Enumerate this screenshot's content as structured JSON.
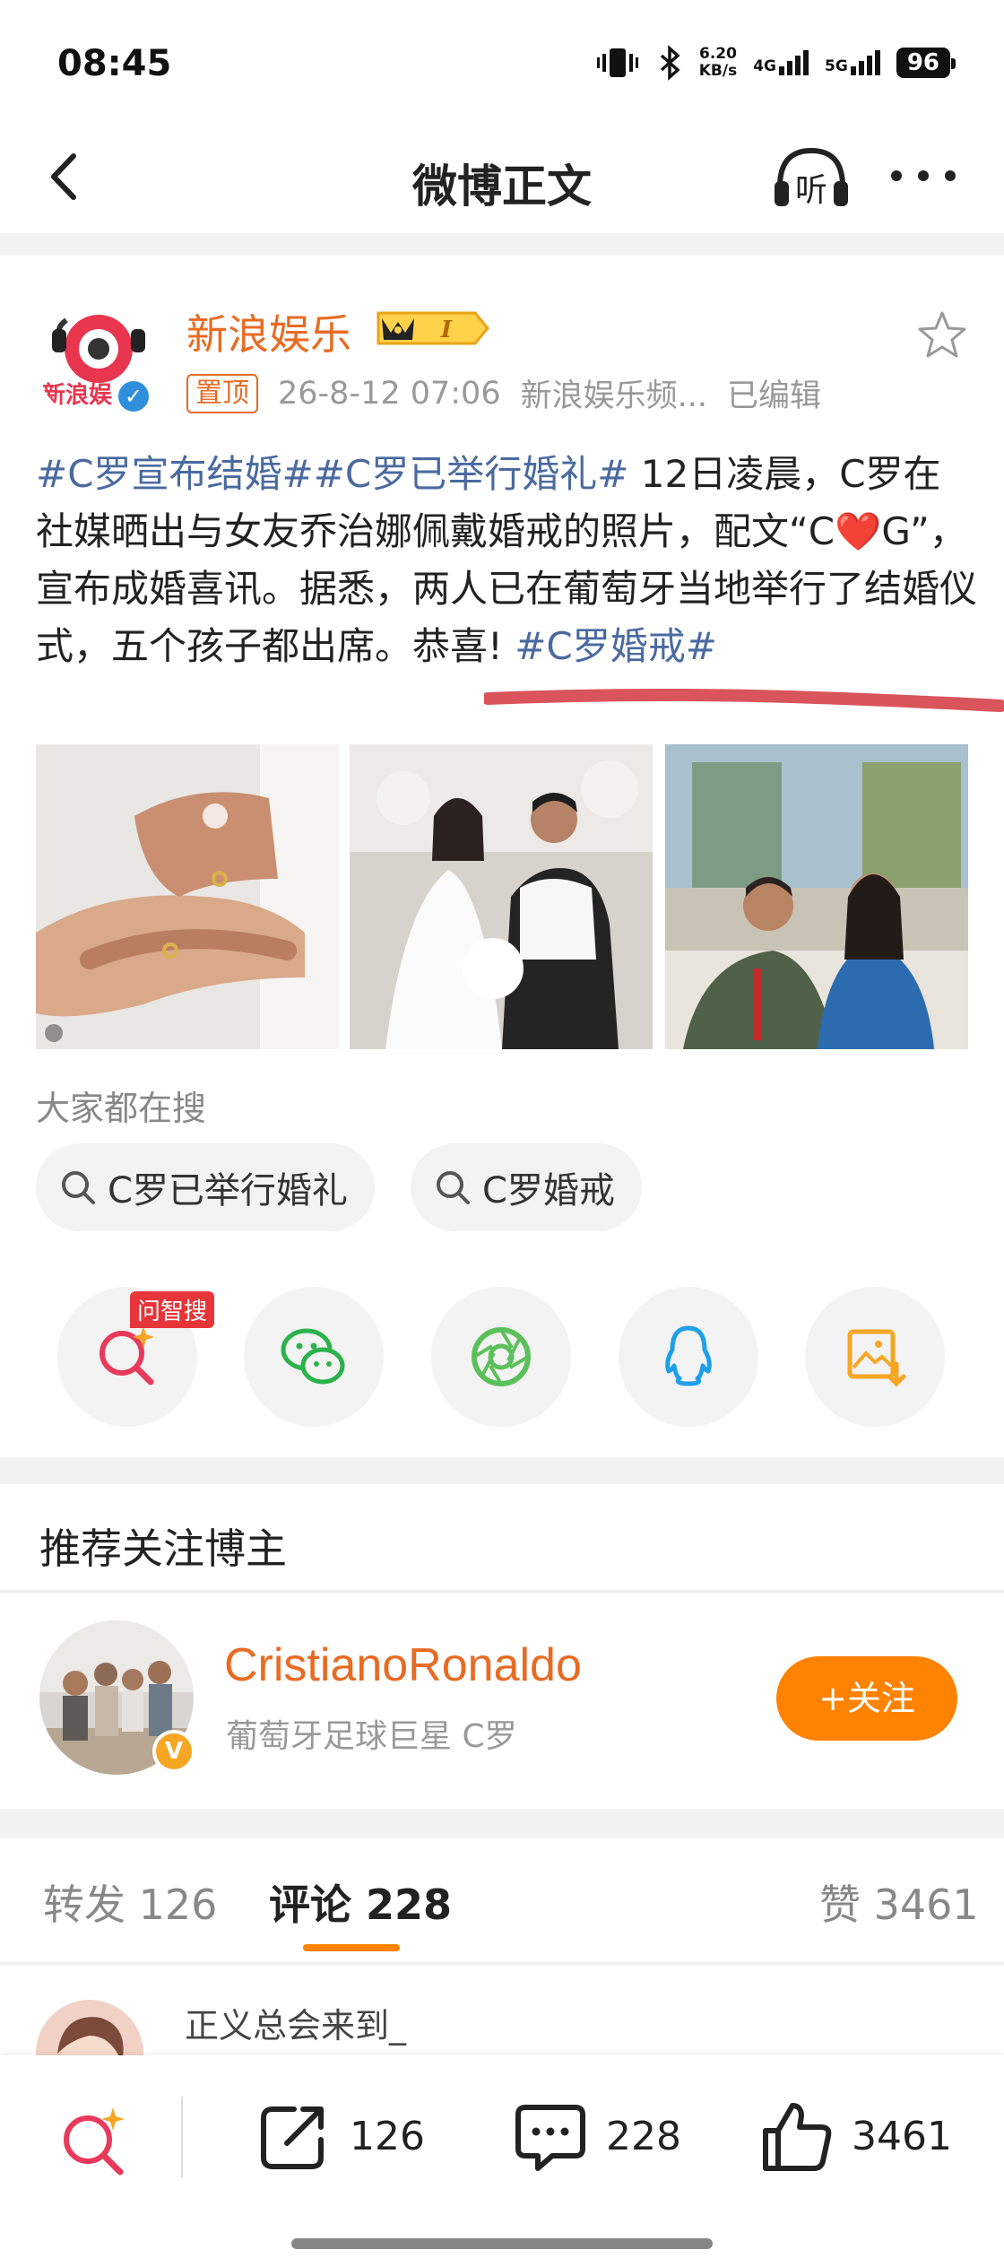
{
  "status": {
    "time": "08:45",
    "net_speed_value": "6.20",
    "net_speed_unit": "KB/s",
    "sig1": "4G",
    "sig2": "5G",
    "battery": "96"
  },
  "nav": {
    "title": "微博正文",
    "listen_label": "听"
  },
  "post": {
    "author": "新浪娱乐",
    "avatar_text": "新浪娱",
    "vip_level": "I",
    "pinned_label": "置顶",
    "datetime": "26-8-12 07:06",
    "source": "新浪娱乐频...",
    "edited": "已编辑",
    "tag1": "#C罗宣布结婚#",
    "tag2": "#C罗已举行婚礼#",
    "text_part1": " 12日凌晨，C罗在社媒晒出与女友乔治娜佩戴婚戒的照片，配文“C",
    "heart": "❤️",
    "text_part2": "G”，宣布成婚喜讯。据悉，两人已在葡萄牙当地举行了结婚仪式，五个孩子都出席。恭喜! ",
    "tag3": "#C罗婚戒#"
  },
  "search": {
    "label": "大家都在搜",
    "chips": [
      "C罗已举行婚礼",
      "C罗婚戒"
    ]
  },
  "share": {
    "ai_tag": "问智搜"
  },
  "recommend": {
    "title": "推荐关注博主",
    "name": "CristianoRonaldo",
    "desc": "葡萄牙足球巨星  C罗",
    "follow": "+关注"
  },
  "tabs": {
    "repost": "转发 126",
    "comment": "评论 228",
    "like": "赞 3461"
  },
  "comment_preview": {
    "name": "正义总会来到_"
  },
  "bottom": {
    "repost": "126",
    "comment": "228",
    "like": "3461"
  },
  "colors": {
    "accent": "#ff8200",
    "author": "#e86b23",
    "hashtag": "#4a6aa0"
  }
}
